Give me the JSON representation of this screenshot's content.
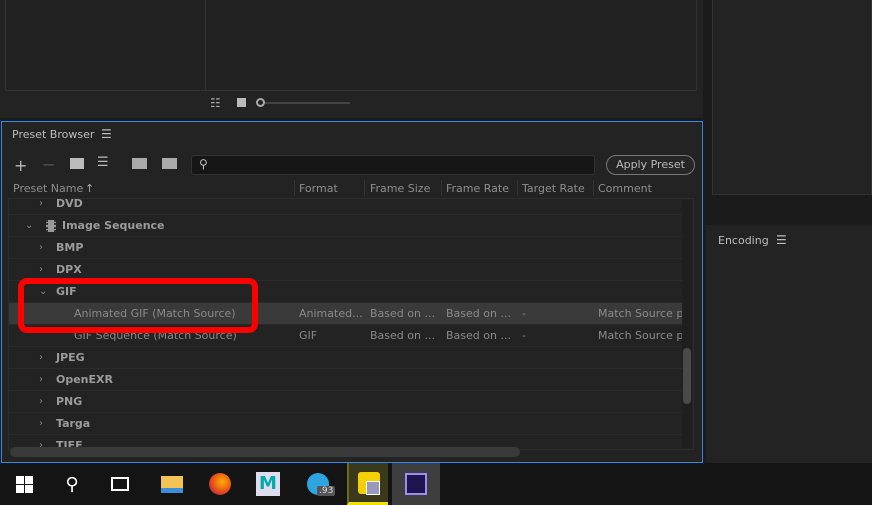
{
  "panel": {
    "title": "Preset Browser",
    "menu_icon": "hamburger-icon"
  },
  "toolbar": {
    "apply_label": "Apply Preset",
    "search_placeholder": ""
  },
  "columns": [
    "Preset Name",
    "Format",
    "Frame Size",
    "Frame Rate",
    "Target Rate",
    "Comment"
  ],
  "rows": [
    {
      "type": "group",
      "label": "DVD",
      "expanded": false,
      "level": 1
    },
    {
      "type": "group",
      "label": "Image Sequence",
      "expanded": true,
      "level": 0
    },
    {
      "type": "group",
      "label": "BMP",
      "expanded": false,
      "level": 1
    },
    {
      "type": "group",
      "label": "DPX",
      "expanded": false,
      "level": 1
    },
    {
      "type": "group",
      "label": "GIF",
      "expanded": true,
      "level": 1
    },
    {
      "type": "preset",
      "label": "Animated GIF (Match Source)",
      "format": "Animated...",
      "frame_size": "Based on ...",
      "frame_rate": "Based on ...",
      "target_rate": "-",
      "comment": "Match Source pre",
      "selected": true
    },
    {
      "type": "preset",
      "label": "GIF Sequence (Match Source)",
      "format": "GIF",
      "frame_size": "Based on ...",
      "frame_rate": "Based on ...",
      "target_rate": "-",
      "comment": "Match Source pre",
      "selected": false
    },
    {
      "type": "group",
      "label": "JPEG",
      "expanded": false,
      "level": 1
    },
    {
      "type": "group",
      "label": "OpenEXR",
      "expanded": false,
      "level": 1
    },
    {
      "type": "group",
      "label": "PNG",
      "expanded": false,
      "level": 1
    },
    {
      "type": "group",
      "label": "Targa",
      "expanded": false,
      "level": 1
    },
    {
      "type": "group",
      "label": "TIFF",
      "expanded": false,
      "level": 1
    }
  ],
  "encoding": {
    "title": "Encoding"
  },
  "taskbar": {
    "telegram_badge": ".93"
  },
  "colors": {
    "highlight": "#ff0000",
    "focus_border": "#2d8ceb"
  }
}
